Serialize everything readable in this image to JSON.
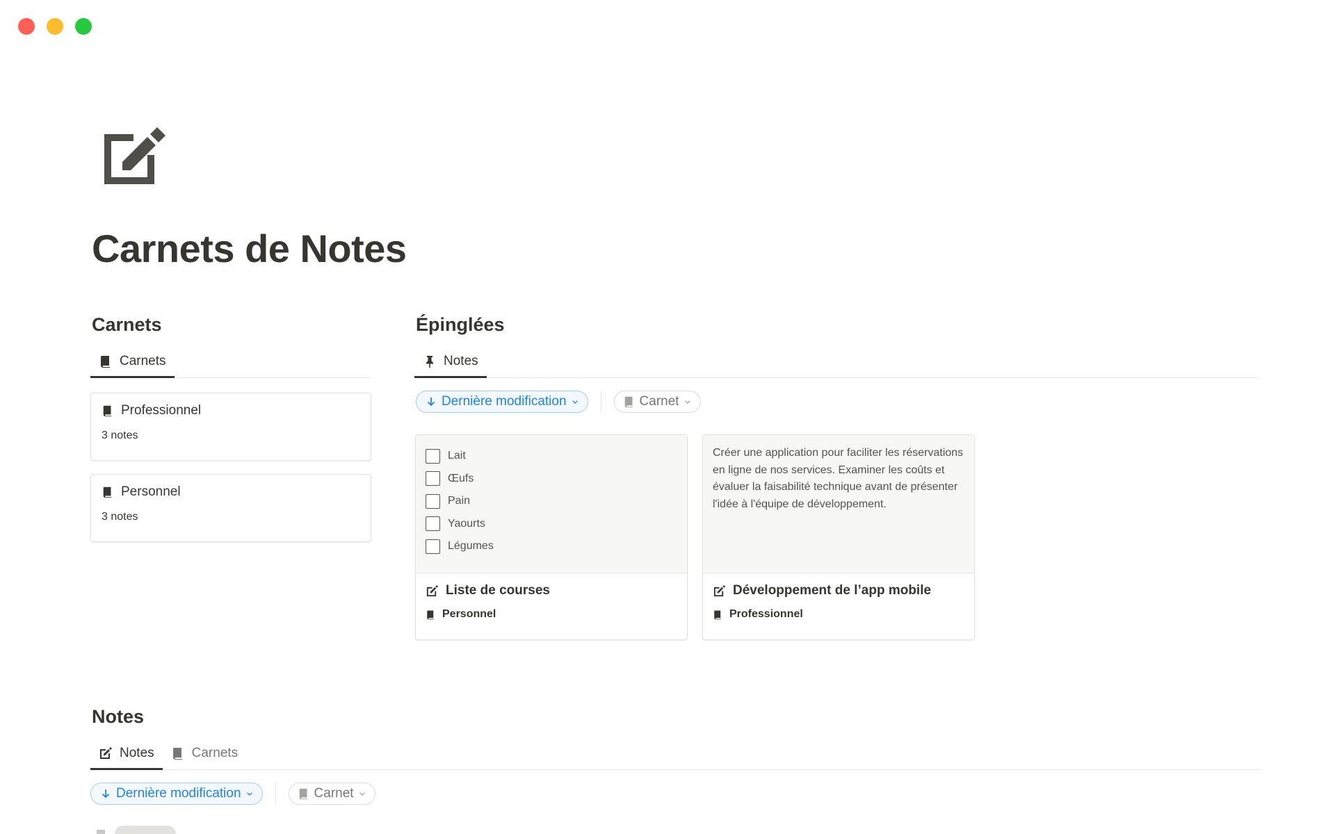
{
  "page": {
    "title": "Carnets de Notes",
    "icon": "edit-note-icon"
  },
  "carnets_section": {
    "heading": "Carnets",
    "tab_label": "Carnets",
    "notebooks": [
      {
        "name": "Professionnel",
        "count": "3 notes"
      },
      {
        "name": "Personnel",
        "count": "3 notes"
      }
    ]
  },
  "pinned_section": {
    "heading": "Épinglées",
    "tab_label": "Notes",
    "sort_label": "Dernière modification",
    "filter_label": "Carnet",
    "cards": [
      {
        "checklist": [
          "Lait",
          "Œufs",
          "Pain",
          "Yaourts",
          "Légumes"
        ],
        "title": "Liste de courses",
        "notebook": "Personnel"
      },
      {
        "text": "Créer une application pour faciliter les réservations en ligne de nos services. Examiner les coûts et évaluer la faisabilité technique avant de présenter l'idée à l'équipe de développement.",
        "title": "Développement de l’app mobile",
        "notebook": "Professionnel"
      }
    ]
  },
  "notes_section": {
    "heading": "Notes",
    "tabs": [
      "Notes",
      "Carnets"
    ],
    "sort_label": "Dernière modification",
    "filter_label": "Carnet"
  },
  "colors": {
    "text": "#37352f",
    "accent": "#2383e2",
    "muted": "#787774",
    "card_preview_bg": "#f7f7f5"
  }
}
